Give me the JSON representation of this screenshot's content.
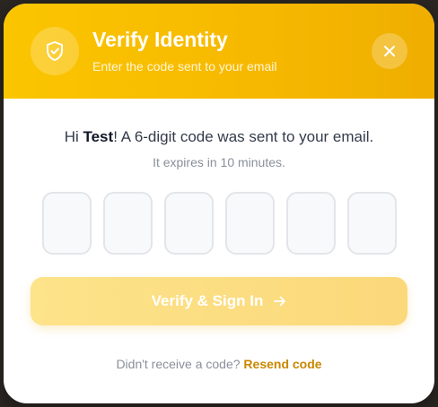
{
  "header": {
    "icon": "shield-check-icon",
    "title": "Verify Identity",
    "subtitle": "Enter the code sent to your email",
    "close_icon": "close-icon",
    "accent_color": "#f6b800"
  },
  "body": {
    "greeting_prefix": "Hi ",
    "user_name": "Test",
    "greeting_suffix": "! A 6-digit code was sent to your email.",
    "expires_text": "It expires in 10 minutes."
  },
  "code": {
    "digits": [
      "",
      "",
      "",
      "",
      "",
      ""
    ]
  },
  "actions": {
    "verify_label": "Verify & Sign In",
    "verify_icon": "arrow-right-icon"
  },
  "footer": {
    "prompt": "Didn't receive a code?",
    "resend_label": "Resend code",
    "link_color": "#c98700"
  }
}
